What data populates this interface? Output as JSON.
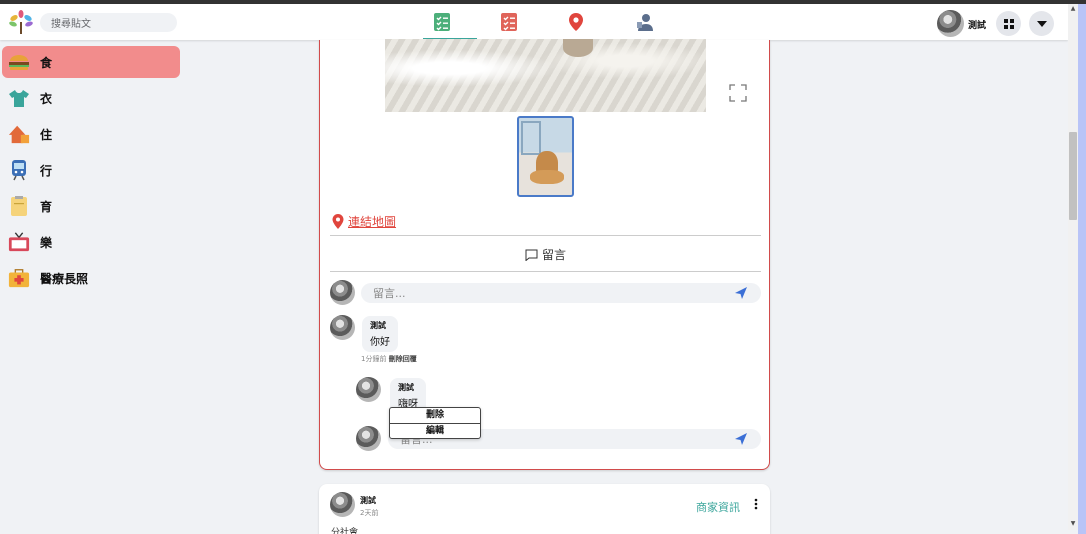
{
  "search": {
    "placeholder": "搜尋貼文"
  },
  "user": {
    "name": "測試"
  },
  "sidebar": {
    "items": [
      {
        "label": "食",
        "icon": "hamburger-icon",
        "active": true
      },
      {
        "label": "衣",
        "icon": "tshirt-icon"
      },
      {
        "label": "住",
        "icon": "house-icon"
      },
      {
        "label": "行",
        "icon": "train-icon"
      },
      {
        "label": "育",
        "icon": "notebook-icon"
      },
      {
        "label": "樂",
        "icon": "tv-icon"
      },
      {
        "label": "醫療長照",
        "icon": "medical-kit-icon"
      }
    ]
  },
  "post": {
    "map_link": "連結地圖",
    "comment_label": "留言",
    "comment_placeholder": "留言...",
    "comments": [
      {
        "author": "測試",
        "text": "你好",
        "time": "1分鐘前",
        "action": "刪除回覆"
      }
    ],
    "reply": {
      "author": "測試",
      "text": "嗨呀"
    },
    "context_menu": {
      "delete": "刪除",
      "edit": "編輯"
    },
    "reply_placeholder": "留言..."
  },
  "post2": {
    "author": "測試",
    "time": "2天前",
    "category": "商家資訊",
    "text": "分社會"
  },
  "colors": {
    "accent": "#3aa59b",
    "active_sidebar": "#f28c8c",
    "link_red": "#e0453d",
    "send_blue": "#3b6fd6"
  }
}
